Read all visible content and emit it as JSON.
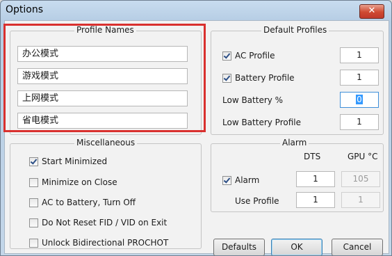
{
  "window": {
    "title": "Options",
    "close_glyph": "✕"
  },
  "profile_names": {
    "title": "Profile Names",
    "items": [
      "办公模式",
      "游戏模式",
      "上网模式",
      "省电模式"
    ]
  },
  "default_profiles": {
    "title": "Default Profiles",
    "ac_profile": {
      "label": "AC Profile",
      "checked": true,
      "value": "1"
    },
    "battery_profile": {
      "label": "Battery Profile",
      "checked": true,
      "value": "1"
    },
    "low_battery_pct": {
      "label": "Low Battery %",
      "value": "0"
    },
    "low_battery_profile": {
      "label": "Low Battery Profile",
      "value": "1"
    }
  },
  "misc": {
    "title": "Miscellaneous",
    "items": [
      {
        "label": "Start Minimized",
        "checked": true
      },
      {
        "label": "Minimize on Close",
        "checked": false
      },
      {
        "label": "AC to Battery, Turn Off",
        "checked": false
      },
      {
        "label": "Do Not Reset FID / VID on Exit",
        "checked": false
      },
      {
        "label": "Unlock Bidirectional PROCHOT",
        "checked": false
      }
    ]
  },
  "alarm": {
    "title": "Alarm",
    "col_dts": "DTS",
    "col_gpu": "GPU °C",
    "alarm_row": {
      "label": "Alarm",
      "checked": true,
      "dts": "1",
      "gpu": "105"
    },
    "use_profile_row": {
      "label": "Use Profile",
      "dts": "1",
      "gpu": "1"
    }
  },
  "buttons": {
    "defaults": "Defaults",
    "ok": "OK",
    "cancel": "Cancel"
  },
  "colors": {
    "highlight": "#d9302e"
  }
}
